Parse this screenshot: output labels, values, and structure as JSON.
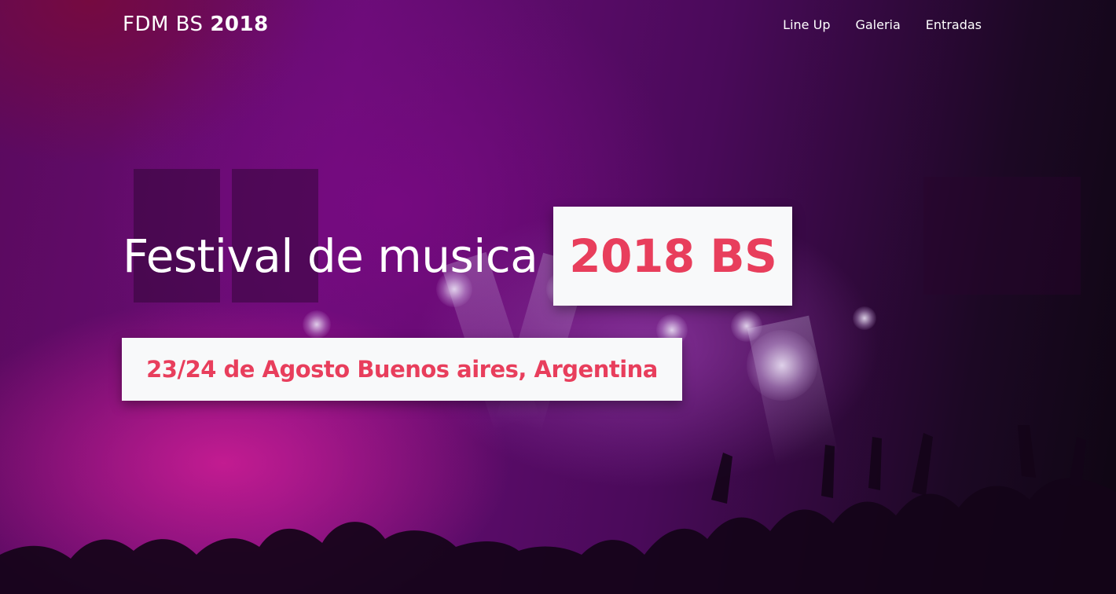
{
  "navbar": {
    "brand_prefix": "FDM BS",
    "brand_year": "2018",
    "links": [
      {
        "label": "Line Up"
      },
      {
        "label": "Galeria"
      },
      {
        "label": "Entradas"
      }
    ]
  },
  "hero": {
    "headline": "Festival de musica",
    "highlight": "2018 BS",
    "subtitle": "23/24 de Agosto Buenos aires, Argentina"
  },
  "colors": {
    "accent": "#e83e5c",
    "box_background": "#f8f9fa",
    "text_light": "#ffffff"
  }
}
